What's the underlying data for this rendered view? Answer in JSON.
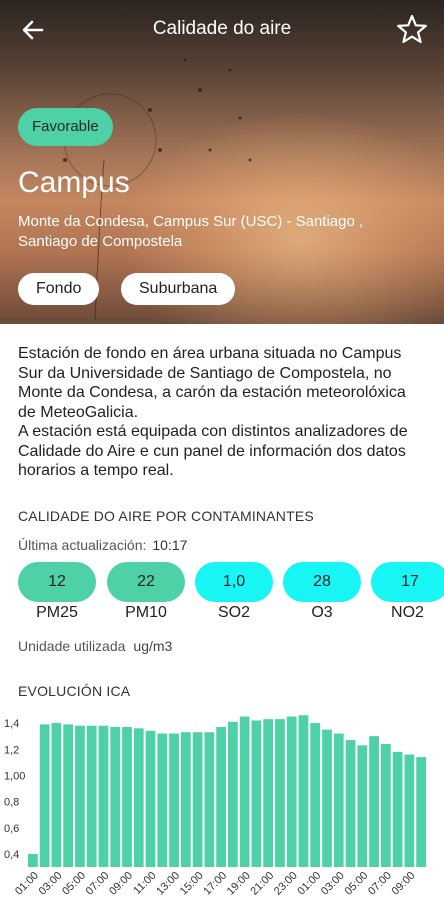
{
  "header": {
    "title": "Calidade do aire"
  },
  "station": {
    "badge": "Favorable",
    "name": "Campus",
    "address": "Monte da Condesa, Campus Sur (USC) - Santiago , Santiago de Compostela",
    "tags": [
      "Fondo",
      "Suburbana"
    ]
  },
  "description": "Estación de fondo en área urbana situada no Campus Sur da Universidade de Santiago de Compostela, no Monte da Condesa, a carón da estación meteorolóxica de MeteoGalicia.\n A estación está equipada con distintos analizadores de Calidade do Aire e cun panel de información dos datos horarios a tempo real.",
  "pollutants_section": {
    "title": "CALIDADE DO AIRE POR CONTAMINANTES",
    "update_label": "Última actualización:",
    "update_value": "10:17",
    "items": [
      {
        "value": "12",
        "name": "PM25",
        "color": "#4fd1a7"
      },
      {
        "value": "22",
        "name": "PM10",
        "color": "#4fd1a7"
      },
      {
        "value": "1,0",
        "name": "SO2",
        "color": "#18f5f5"
      },
      {
        "value": "28",
        "name": "O3",
        "color": "#18f5f5"
      },
      {
        "value": "17",
        "name": "NO2",
        "color": "#18f5f5"
      }
    ],
    "unit_label": "Unidade utilizada",
    "unit_value": "ug/m3"
  },
  "evolution": {
    "title": "EVOLUCIÓN ICA"
  },
  "chart_data": {
    "type": "bar",
    "title": "EVOLUCIÓN ICA",
    "ylim": [
      0.3,
      1.5
    ],
    "yticks": [
      "0,4",
      "0,6",
      "0,8",
      "1,00",
      "1,2",
      "1,4"
    ],
    "bar_color": "#4fd1a7",
    "grid": false,
    "xtick_labels": [
      "01:00",
      "03:00",
      "05:00",
      "07:00",
      "09:00",
      "11:00",
      "13:00",
      "15:00",
      "17:00",
      "19:00",
      "21:00",
      "23:00",
      "01:00",
      "03:00",
      "05:00",
      "07:00",
      "09:00"
    ],
    "values": [
      0.4,
      1.39,
      1.4,
      1.39,
      1.38,
      1.38,
      1.38,
      1.37,
      1.37,
      1.36,
      1.34,
      1.32,
      1.32,
      1.33,
      1.33,
      1.33,
      1.37,
      1.41,
      1.45,
      1.42,
      1.43,
      1.43,
      1.45,
      1.46,
      1.4,
      1.35,
      1.32,
      1.27,
      1.23,
      1.3,
      1.24,
      1.18,
      1.16,
      1.14
    ]
  }
}
